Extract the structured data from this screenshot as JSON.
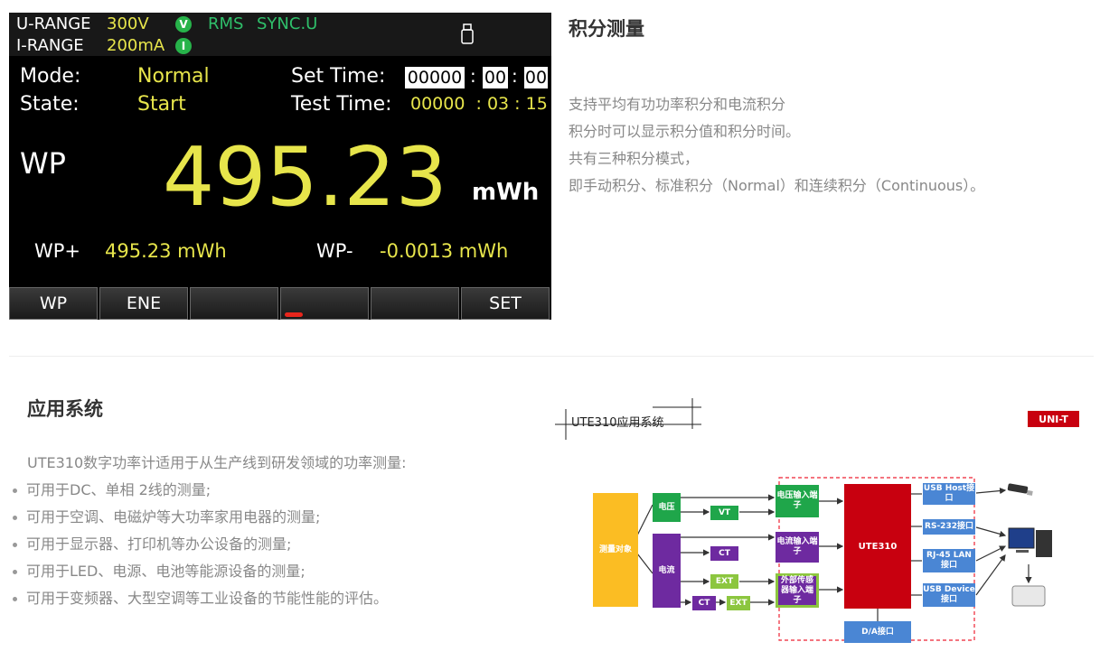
{
  "screen": {
    "u_range_label": "U-RANGE",
    "u_range_value": "300V",
    "i_range_label": "I-RANGE",
    "i_range_value": "200mA",
    "v_indicator": "V",
    "i_indicator": "I",
    "rms": "RMS",
    "sync": "SYNC.U",
    "usb_icon": "usb-icon",
    "mode_label": "Mode:",
    "mode_value": "Normal",
    "state_label": "State:",
    "state_value": "Start",
    "set_time_label": "Set Time:",
    "set_time_h": "00000",
    "set_time_m": "00",
    "set_time_s": "00",
    "test_time_label": "Test Time:",
    "test_time_value": "00000  : 03 : 15",
    "colon": ":",
    "main_label": "WP",
    "main_value": "495.23",
    "main_unit": "mWh",
    "wp_plus_label": "WP+",
    "wp_plus_value": "495.23 mWh",
    "wp_minus_label": "WP-",
    "wp_minus_value": "-0.0013 mWh",
    "softkeys": [
      "WP",
      "ENE",
      "",
      "",
      "",
      "SET"
    ]
  },
  "section1": {
    "title": "积分测量",
    "lines": [
      "支持平均有功功率积分和电流积分",
      "积分时可以显示积分值和积分时间。",
      "共有三种积分模式，",
      "即手动积分、标准积分（Normal）和连续积分（Continuous）。"
    ]
  },
  "section2": {
    "title": "应用系统",
    "intro": "UTE310数字功率计适用于从生产线到研发领域的功率测量:",
    "items": [
      "可用于DC、单相 2线的测量;",
      "可用于空调、电磁炉等大功率家用电器的测量;",
      "可用于显示器、打印机等办公设备的测量;",
      "可用于LED、电源、电池等能源设备的测量;",
      "可用于变频器、大型空调等工业设备的节能性能的评估。"
    ]
  },
  "diagram": {
    "title": "UTE310应用系统",
    "logo": "UNI-T",
    "target": "测量对象",
    "voltage": "电压",
    "current": "电流",
    "vt": "VT",
    "ct": "CT",
    "ext": "EXT",
    "v_input": "电压输入端子",
    "i_input": "电流输入端子",
    "ext_input": "外部传感器输入端子",
    "main": "UTE310",
    "usb_host": "USB Host接口",
    "rs232": "RS-232接口",
    "lan": "RJ-45 LAN接口",
    "usb_device": "USB Device接口",
    "da": "D/A接口",
    "colors": {
      "green": "#1fa64a",
      "purple": "#6e2aa0",
      "yellow": "#fbbd23",
      "red": "#c8000f",
      "blue": "#4a86d4",
      "lime": "#8cc63f"
    }
  }
}
